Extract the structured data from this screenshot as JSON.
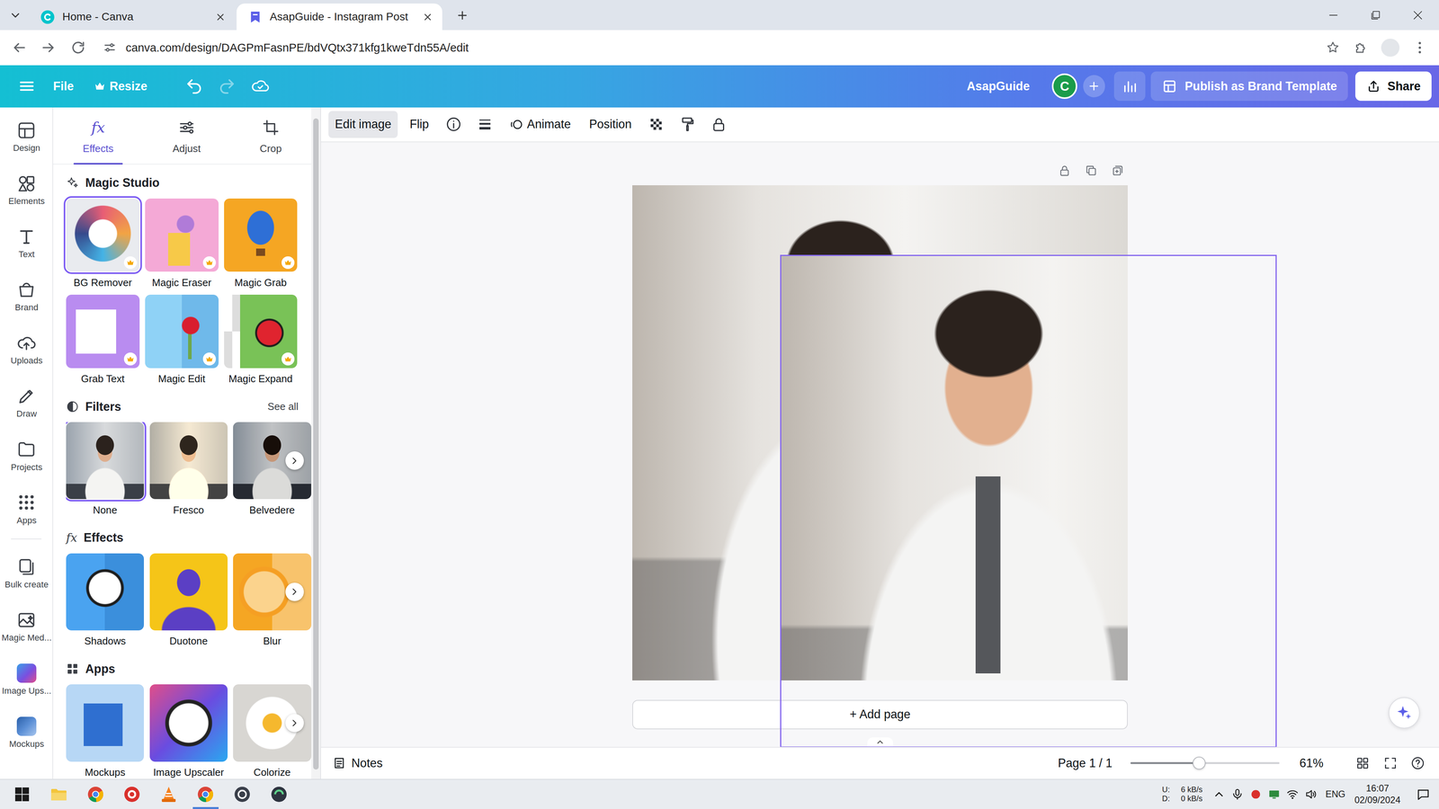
{
  "browser": {
    "tabs": [
      {
        "label": "Home - Canva",
        "selected": false
      },
      {
        "label": "AsapGuide - Instagram Post",
        "selected": true
      }
    ],
    "url": "canva.com/design/DAGPmFasnPE/bdVQtx371kfg1kweTdn55A/edit"
  },
  "topbar": {
    "file": "File",
    "resize": "Resize",
    "history": [
      {
        "kind": "undo",
        "disabled": false
      },
      {
        "kind": "redo",
        "disabled": true
      }
    ],
    "team": "AsapGuide",
    "avatar": "C",
    "publish": "Publish as Brand Template",
    "share": "Share"
  },
  "rail": [
    "Design",
    "Elements",
    "Text",
    "Brand",
    "Uploads",
    "Draw",
    "Projects",
    "Apps",
    "Bulk create",
    "Magic Med...",
    "Image Ups...",
    "Mockups"
  ],
  "panel": {
    "fx_icon": "fx",
    "tabs": [
      {
        "label": "Effects",
        "selected": true
      },
      {
        "label": "Adjust",
        "selected": false
      },
      {
        "label": "Crop",
        "selected": false
      }
    ],
    "sections": [
      {
        "title": "Magic Studio",
        "kind": "grid",
        "items": [
          {
            "label": "BG Remover",
            "selected": true
          },
          {
            "label": "Magic Eraser",
            "selected": false
          },
          {
            "label": "Magic Grab",
            "selected": false
          },
          {
            "label": "Grab Text",
            "selected": false
          },
          {
            "label": "Magic Edit",
            "selected": false
          },
          {
            "label": "Magic Expand",
            "selected": false
          }
        ]
      },
      {
        "title": "Filters",
        "kind": "carousel",
        "see_all": "See all",
        "items": [
          {
            "label": "None",
            "selected": true
          },
          {
            "label": "Fresco",
            "selected": false
          },
          {
            "label": "Belvedere",
            "selected": false
          }
        ]
      },
      {
        "title": "Effects",
        "kind": "carousel",
        "items": [
          {
            "label": "Shadows"
          },
          {
            "label": "Duotone"
          },
          {
            "label": "Blur"
          }
        ]
      },
      {
        "title": "Apps",
        "kind": "carousel",
        "items": [
          {
            "label": "Mockups"
          },
          {
            "label": "Image Upscaler"
          },
          {
            "label": "Colorize"
          }
        ]
      }
    ]
  },
  "toolbar": {
    "items": [
      {
        "label": "Edit image",
        "selected": true
      },
      {
        "label": "Flip",
        "selected": false
      }
    ],
    "animate": "Animate",
    "position": "Position"
  },
  "canvas": {
    "add_page": "+ Add page"
  },
  "footer": {
    "notes": "Notes",
    "page": "Page 1 / 1",
    "zoom_level": 0.46,
    "zoom": "61%"
  },
  "taskbar": {
    "net": [
      {
        "label": "U:",
        "rate": "6 kB/s"
      },
      {
        "label": "D:",
        "rate": "0 kB/s"
      }
    ],
    "lang": "ENG",
    "time": "16:07",
    "date": "02/09/2024"
  }
}
